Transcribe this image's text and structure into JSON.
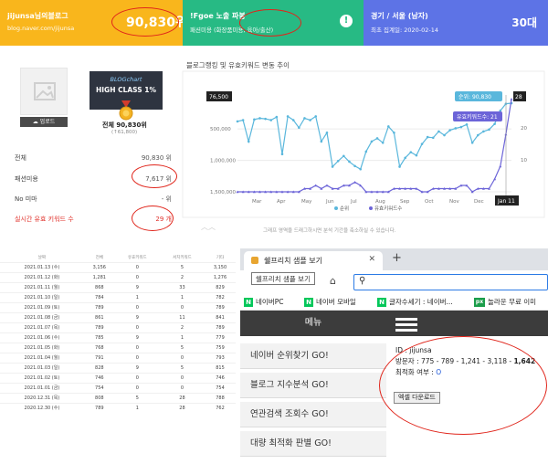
{
  "banner": {
    "card1": {
      "title": "jijunsa님의블로그",
      "subtitle": "blog.naver.com/jijunsa",
      "value": "90,830위"
    },
    "card2": {
      "title": "!Fgoe 노출 파봉",
      "subtitle": "패션미용 (화장품미용, 육아/출산)"
    },
    "card3": {
      "title": "경기 / 서울 (남자)",
      "subtitle": "최초 집계일: 2020-02-14",
      "value": "30대"
    }
  },
  "left": {
    "upload_label": "업로드",
    "badge_brand": "BLOGchart",
    "badge_text": "HIGH CLASS 1%",
    "rank_label": "전체 90,830위",
    "rank_change": "(↑61,800)",
    "stats": [
      {
        "label": "전체",
        "value": "90,830 위"
      },
      {
        "label": "패션미용",
        "value": "7,617 위"
      },
      {
        "label": "No 미마",
        "value": "- 위"
      },
      {
        "label": "실시간 유효 키워드 수",
        "value": "29 개"
      }
    ]
  },
  "chart": {
    "title": "블로그랭킹 및 유효키워드 변동 추이",
    "footnote": "그래프 영역을 드래그하시면 분석 기간을 축소하실 수 있습니다.",
    "icon": "sparkline-icon"
  },
  "chart_data": {
    "type": "line",
    "x_ticks": [
      "Mar",
      "Apr",
      "May",
      "Jun",
      "Jul",
      "Aug",
      "Sep",
      "Oct",
      "Nov",
      "Dec"
    ],
    "y_left_ticks": [
      "500,000",
      "1,000,000",
      "1,500,000"
    ],
    "y_left_range": [
      76500,
      1500000
    ],
    "y_left_inverted": true,
    "y_right_ticks": [
      "10",
      "20"
    ],
    "y_right_range": [
      0,
      28
    ],
    "series": [
      {
        "name": "순위",
        "color": "#5ab7dc",
        "axis": "left",
        "values": [
          380000,
          360000,
          700000,
          350000,
          330000,
          340000,
          360000,
          310000,
          900000,
          300000,
          360000,
          480000,
          330000,
          360000,
          300000,
          700000,
          560000,
          1100000,
          1010000,
          930000,
          1020000,
          1090000,
          1140000,
          860000,
          700000,
          650000,
          720000,
          460000,
          560000,
          1100000,
          960000,
          870000,
          920000,
          740000,
          630000,
          640000,
          540000,
          600000,
          520000,
          490000,
          470000,
          430000,
          720000,
          600000,
          540000,
          510000,
          420000,
          210000,
          100000,
          90830
        ]
      },
      {
        "name": "유효키워드수",
        "color": "#6c64d8",
        "axis": "right",
        "values": [
          0,
          0,
          0,
          0,
          0,
          0,
          0,
          0,
          0,
          0,
          0,
          0,
          1,
          1,
          2,
          1,
          2,
          1,
          1,
          2,
          2,
          3,
          2,
          0,
          0,
          0,
          0,
          0,
          1,
          1,
          1,
          1,
          1,
          0,
          0,
          1,
          1,
          1,
          1,
          1,
          2,
          2,
          0,
          1,
          1,
          1,
          4,
          8,
          18,
          29
        ]
      }
    ],
    "tooltip_left": "76,500",
    "tooltip_right": "28",
    "hover_label_rank": "순위: 90,830",
    "hover_label_kw": "유효키워드수: 21",
    "hover_date": "Jan 11",
    "legend": [
      {
        "label": "순위",
        "color": "#5ab7dc"
      },
      {
        "label": "유효키워드수",
        "color": "#6c64d8"
      }
    ]
  },
  "table": {
    "headers": [
      "날짜",
      "전체",
      "유효키워드",
      "서치키워드",
      "기타"
    ],
    "rows": [
      [
        "2021.01.13 (수)",
        "3,156",
        "0",
        "5",
        "3,150"
      ],
      [
        "2021.01.12 (화)",
        "1,281",
        "0",
        "2",
        "1,276"
      ],
      [
        "2021.01.11 (월)",
        "868",
        "9",
        "33",
        "829"
      ],
      [
        "2021.01.10 (일)",
        "784",
        "1",
        "1",
        "782"
      ],
      [
        "2021.01.09 (토)",
        "789",
        "0",
        "0",
        "789"
      ],
      [
        "2021.01.08 (금)",
        "861",
        "9",
        "11",
        "841"
      ],
      [
        "2021.01.07 (목)",
        "789",
        "0",
        "2",
        "789"
      ],
      [
        "2021.01.06 (수)",
        "785",
        "9",
        "1",
        "779"
      ],
      [
        "2021.01.05 (화)",
        "768",
        "0",
        "5",
        "759"
      ],
      [
        "2021.01.04 (월)",
        "791",
        "0",
        "0",
        "793"
      ],
      [
        "2021.01.03 (일)",
        "828",
        "9",
        "5",
        "815"
      ],
      [
        "2021.01.02 (토)",
        "746",
        "0",
        "0",
        "746"
      ],
      [
        "2021.01.01 (금)",
        "754",
        "0",
        "0",
        "754"
      ],
      [
        "2020.12.31 (목)",
        "808",
        "5",
        "28",
        "788"
      ],
      [
        "2020.12.30 (수)",
        "789",
        "1",
        "28",
        "762"
      ]
    ]
  },
  "browser": {
    "tab_title": "쉘프리치 샘플 보기",
    "tooltip": "쉘프리치 샘플 보기",
    "bookmarks": [
      {
        "icon": "N",
        "label": "네이버PC"
      },
      {
        "icon": "N",
        "label": "네이버 모바일"
      },
      {
        "icon": "N",
        "label": "글자수세기 : 네이버..."
      },
      {
        "icon": "px",
        "label": "놀라운 무료 이미"
      }
    ],
    "menu_title": "메뉴",
    "menu_items": [
      "네이버 순위찾기 GO!",
      "블로그 지수분석 GO!",
      "연관검색 조회수 GO!",
      "대량 최적화 판별 GO!"
    ],
    "info": {
      "id_line": "ID : jijunsa",
      "visitors_prefix": "방문자 : 775 - 789 - 1,241 - 3,118 - ",
      "visitors_last": "1,642",
      "optim_prefix": "최적화 여부 : ",
      "optim_value": "O"
    },
    "excel_button": "엑셀 다운로드"
  }
}
